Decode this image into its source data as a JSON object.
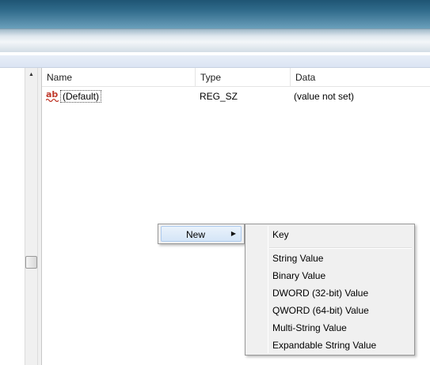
{
  "list": {
    "columns": {
      "name": "Name",
      "type": "Type",
      "data": "Data"
    },
    "rows": [
      {
        "name": "(Default)",
        "type": "REG_SZ",
        "data": "(value not set)",
        "icon": "string-value-icon"
      }
    ]
  },
  "context_menu": {
    "items": [
      {
        "label": "New",
        "has_submenu": true
      }
    ]
  },
  "submenu": {
    "items": [
      {
        "label": "Key"
      },
      {
        "label": "String Value"
      },
      {
        "label": "Binary Value"
      },
      {
        "label": "DWORD (32-bit) Value"
      },
      {
        "label": "QWORD (64-bit) Value"
      },
      {
        "label": "Multi-String Value"
      },
      {
        "label": "Expandable String Value"
      }
    ]
  },
  "icons": {
    "value_icon_text": "ab",
    "submenu_arrow": "▶",
    "scroll_up": "▲"
  },
  "colors": {
    "titlebar": "#2f6a8a",
    "menu_background": "#f0f0f0",
    "highlight": "#d4e5f7",
    "string_icon": "#c0392b"
  }
}
